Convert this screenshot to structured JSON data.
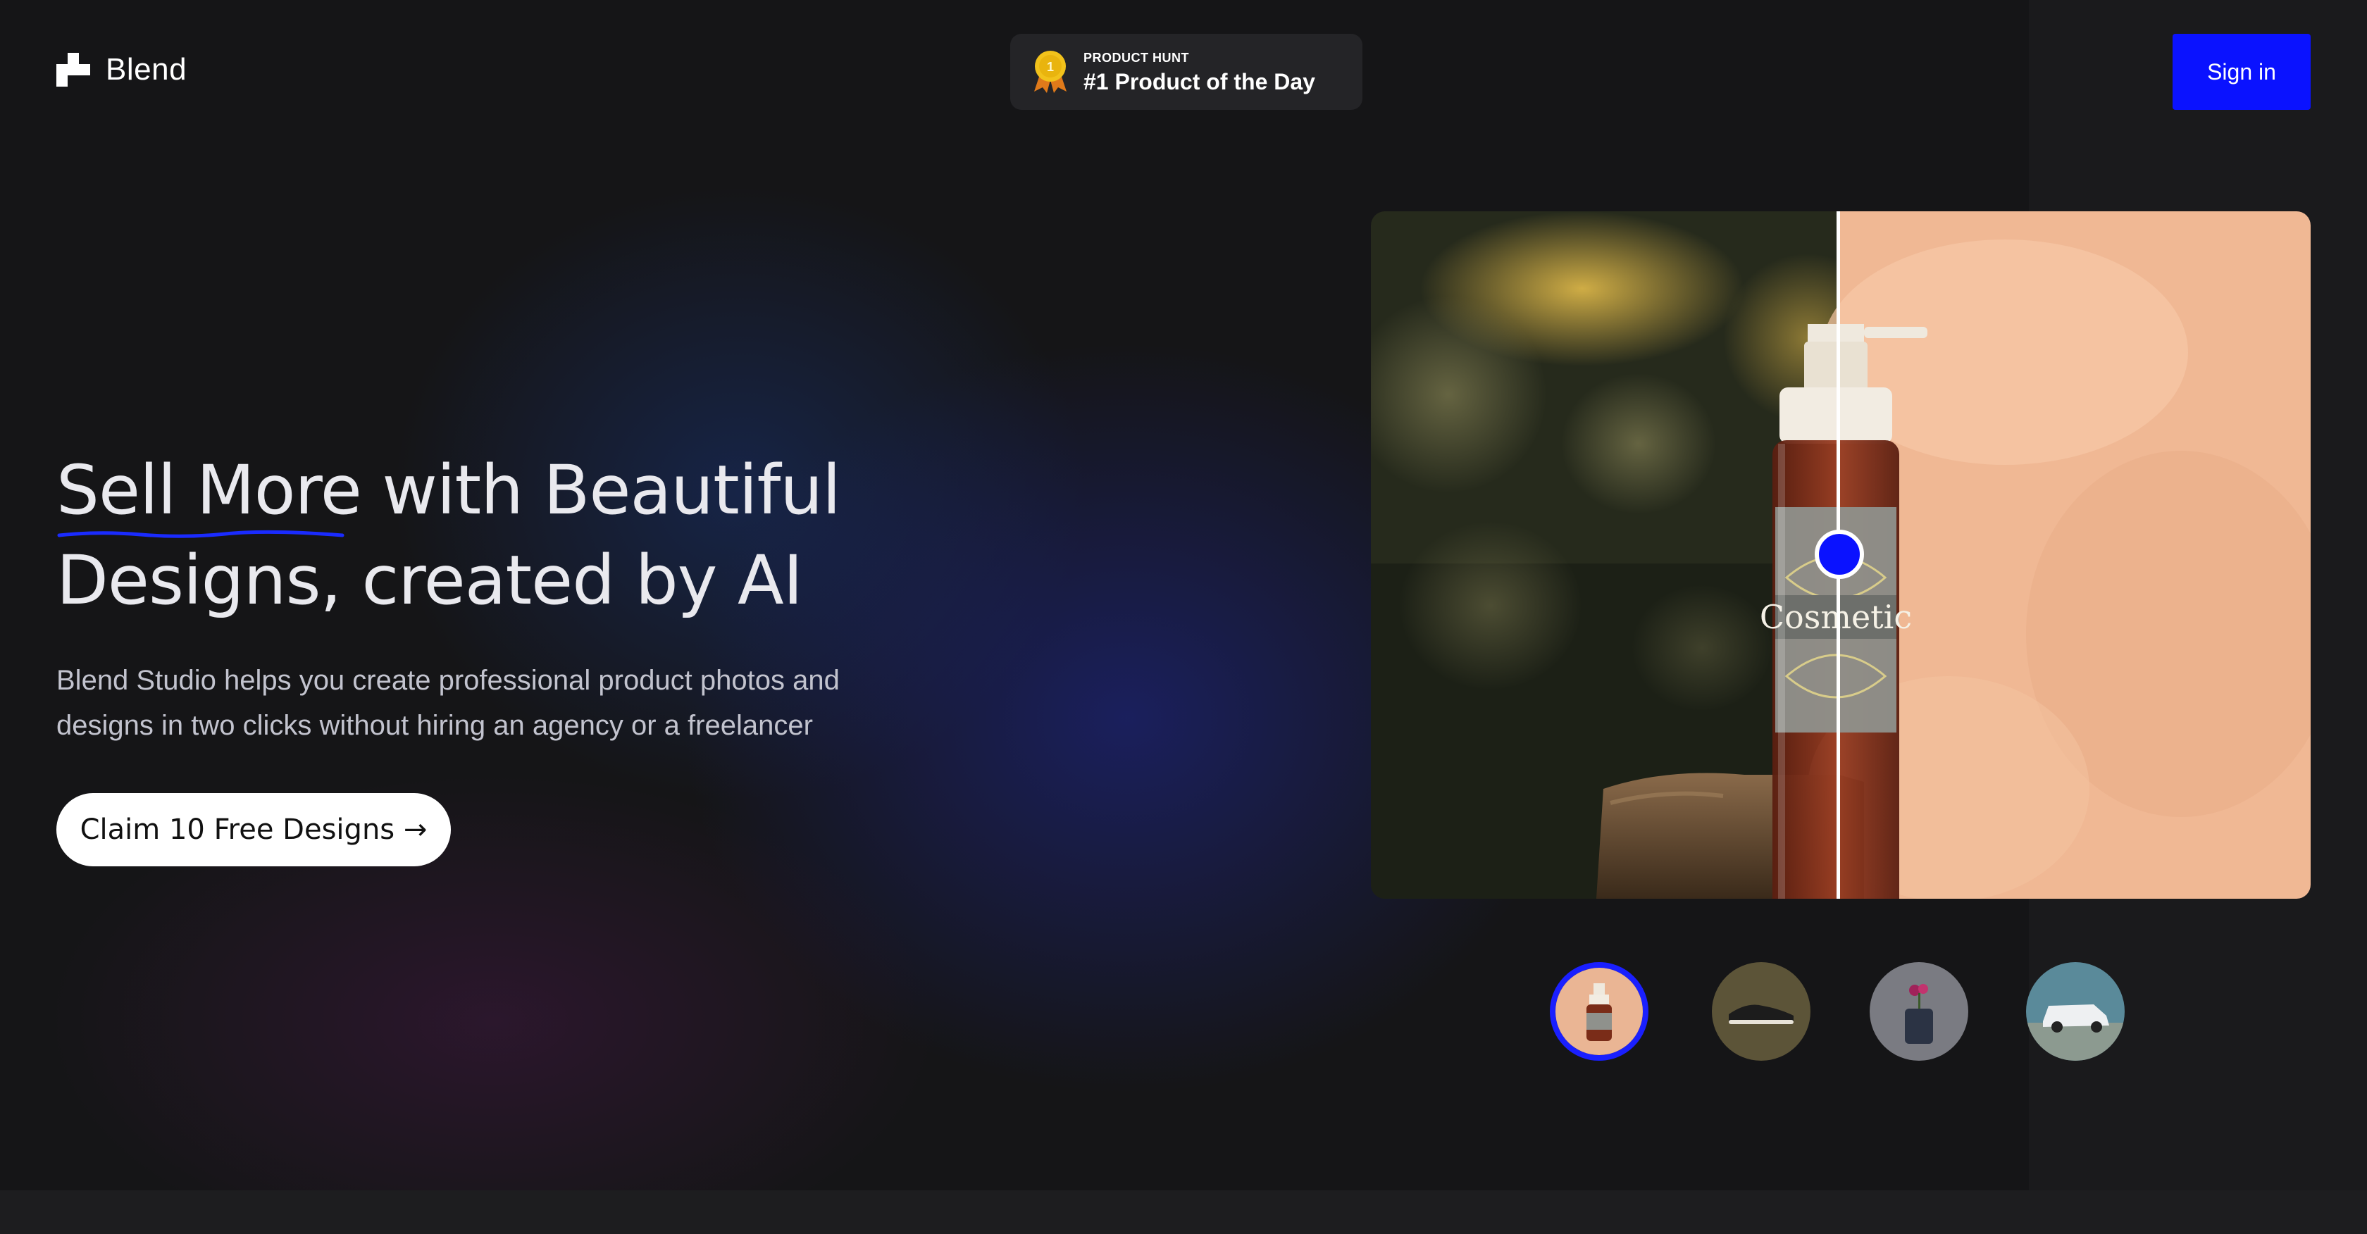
{
  "header": {
    "logo_text": "Blend",
    "badge": {
      "kicker": "PRODUCT HUNT",
      "title": "#1 Product of the Day",
      "medal_number": "1"
    },
    "signin_label": "Sign in"
  },
  "hero": {
    "headline_highlight": "Sell More",
    "headline_rest": " with Beautiful Designs, created by AI",
    "subtext": "Blend Studio helps you create professional product photos and designs in two clicks without hiring an agency or a freelancer",
    "cta_label": "Claim 10 Free Designs →"
  },
  "showcase": {
    "product_label": "Cosmetic",
    "thumbnails": [
      {
        "name": "cosmetic bottle",
        "active": true
      },
      {
        "name": "sneaker",
        "active": false
      },
      {
        "name": "flower vase",
        "active": false
      },
      {
        "name": "white SUV",
        "active": false
      }
    ]
  },
  "colors": {
    "accent": "#0a12ff",
    "background": "#151517"
  }
}
